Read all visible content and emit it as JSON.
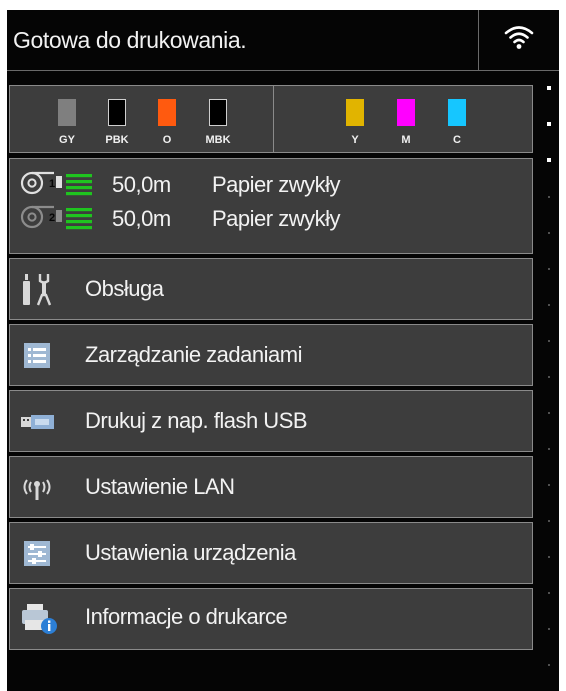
{
  "status": {
    "message": "Gotowa do drukowania.",
    "wifi_icon": "wifi-icon"
  },
  "inks": {
    "left_group": [
      {
        "code": "GY",
        "color": "#7f7f7f"
      },
      {
        "code": "PBK",
        "color": "#000000"
      },
      {
        "code": "O",
        "color": "#ff5a0f"
      },
      {
        "code": "MBK",
        "color": "#000000"
      }
    ],
    "right_group": [
      {
        "code": "Y",
        "color": "#e1b400"
      },
      {
        "code": "M",
        "color": "#ff00ff"
      },
      {
        "code": "C",
        "color": "#16c6ff"
      }
    ]
  },
  "paper": {
    "rolls": [
      {
        "roll": "1",
        "length": "50,0m",
        "type": "Papier zwykły"
      },
      {
        "roll": "2",
        "length": "50,0m",
        "type": "Papier zwykły"
      }
    ],
    "level_color": "#1fc41f"
  },
  "menu": [
    {
      "label": "Obsługa",
      "icon": "tools-icon"
    },
    {
      "label": "Zarządzanie zadaniami",
      "icon": "job-list-icon"
    },
    {
      "label": "Drukuj z nap. flash USB",
      "icon": "usb-drive-icon"
    },
    {
      "label": "Ustawienie LAN",
      "icon": "lan-antenna-icon"
    },
    {
      "label": "Ustawienia urządzenia",
      "icon": "device-settings-icon"
    },
    {
      "label": "Informacje o drukarce",
      "icon": "printer-info-icon"
    }
  ]
}
